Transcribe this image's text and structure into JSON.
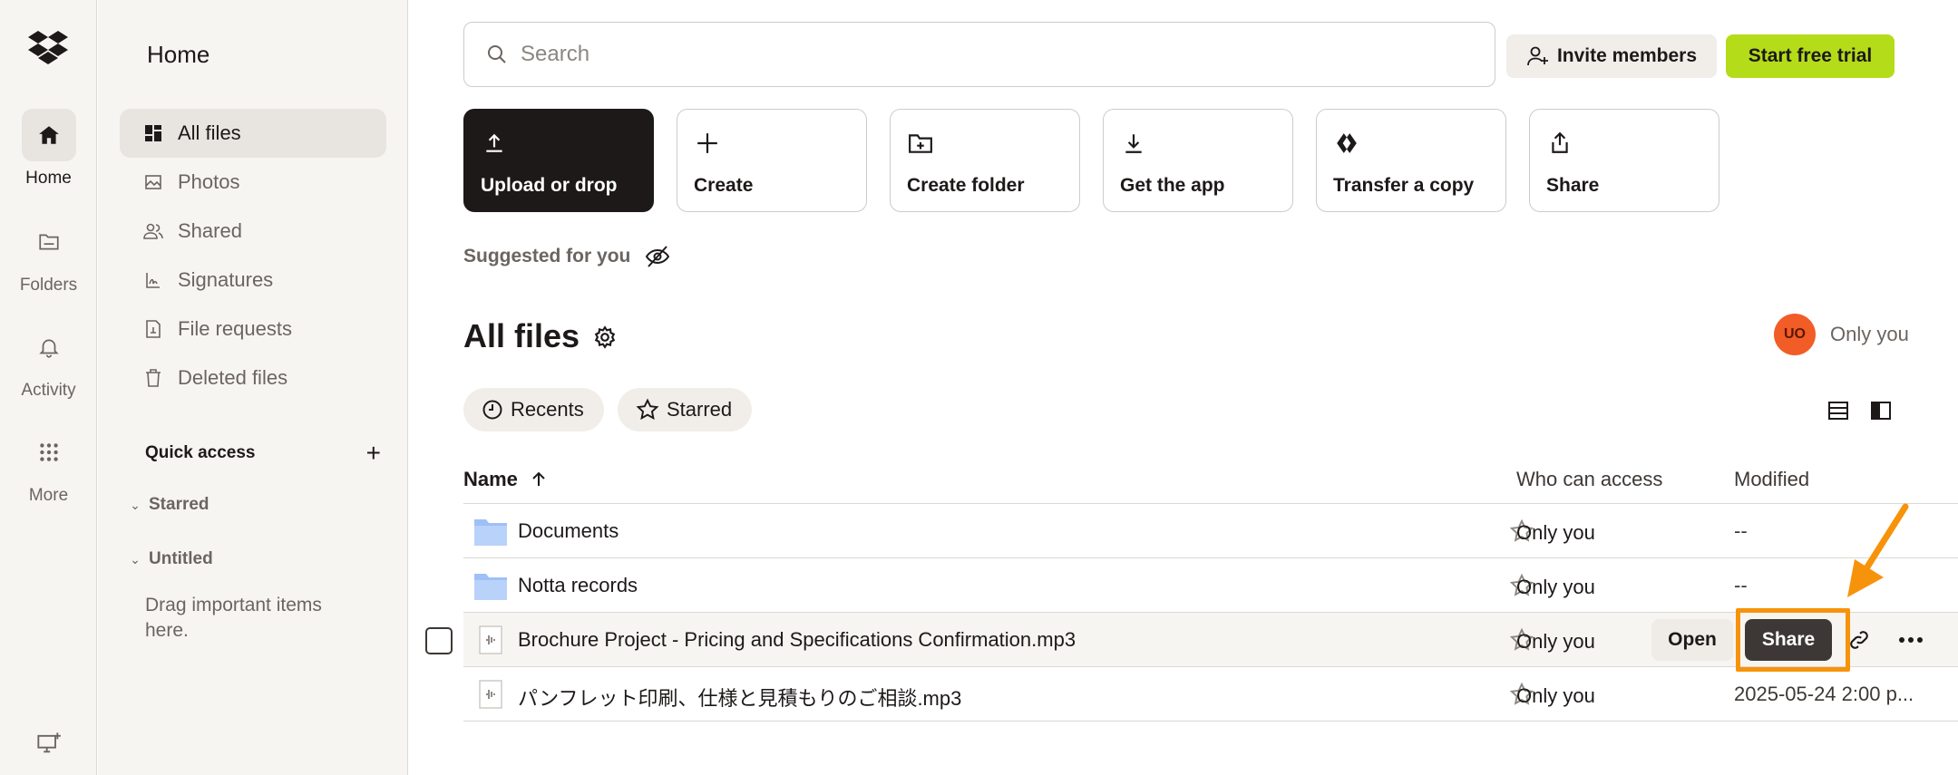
{
  "rail": {
    "items": [
      {
        "label": "Home",
        "icon": "home-icon"
      },
      {
        "label": "Folders",
        "icon": "folder-icon"
      },
      {
        "label": "Activity",
        "icon": "bell-icon"
      },
      {
        "label": "More",
        "icon": "grid-icon"
      }
    ]
  },
  "sidenav": {
    "title": "Home",
    "items": [
      {
        "label": "All files",
        "icon": "all-files-icon"
      },
      {
        "label": "Photos",
        "icon": "photo-icon"
      },
      {
        "label": "Shared",
        "icon": "shared-icon"
      },
      {
        "label": "Signatures",
        "icon": "signature-icon"
      },
      {
        "label": "File requests",
        "icon": "file-request-icon"
      },
      {
        "label": "Deleted files",
        "icon": "trash-icon"
      }
    ],
    "quick_access": "Quick access",
    "groups": [
      "Starred",
      "Untitled"
    ],
    "drag_hint": "Drag important items here."
  },
  "header": {
    "search_placeholder": "Search",
    "invite_label": "Invite members",
    "trial_label": "Start free trial"
  },
  "tiles": [
    {
      "label": "Upload or drop",
      "icon": "upload-icon"
    },
    {
      "label": "Create",
      "icon": "plus-icon"
    },
    {
      "label": "Create folder",
      "icon": "folder-plus-icon"
    },
    {
      "label": "Get the app",
      "icon": "download-icon"
    },
    {
      "label": "Transfer a copy",
      "icon": "transfer-icon"
    },
    {
      "label": "Share",
      "icon": "share-icon"
    }
  ],
  "suggested_label": "Suggested for you",
  "files_section": {
    "title": "All files",
    "owner_initials": "UO",
    "owner_label": "Only you",
    "chips": [
      "Recents",
      "Starred"
    ]
  },
  "table": {
    "columns": {
      "name": "Name",
      "access": "Who can access",
      "modified": "Modified"
    },
    "rows": [
      {
        "name": "Documents",
        "type": "folder",
        "access": "Only you",
        "modified": "--"
      },
      {
        "name": "Notta records",
        "type": "folder",
        "access": "Only you",
        "modified": "--"
      },
      {
        "name": "Brochure Project - Pricing and Specifications Confirmation.mp3",
        "type": "audio",
        "access": "Only you",
        "modified": ""
      },
      {
        "name": "パンフレット印刷、仕様と見積もりのご相談.mp3",
        "type": "audio",
        "access": "Only you",
        "modified": "2025-05-24 2:00 p..."
      }
    ],
    "row_actions": {
      "open": "Open",
      "share": "Share"
    }
  },
  "colors": {
    "accent": "#b4dc19",
    "highlight": "#f7930a",
    "avatar": "#f25c27",
    "folder": "#9ec0f7"
  }
}
